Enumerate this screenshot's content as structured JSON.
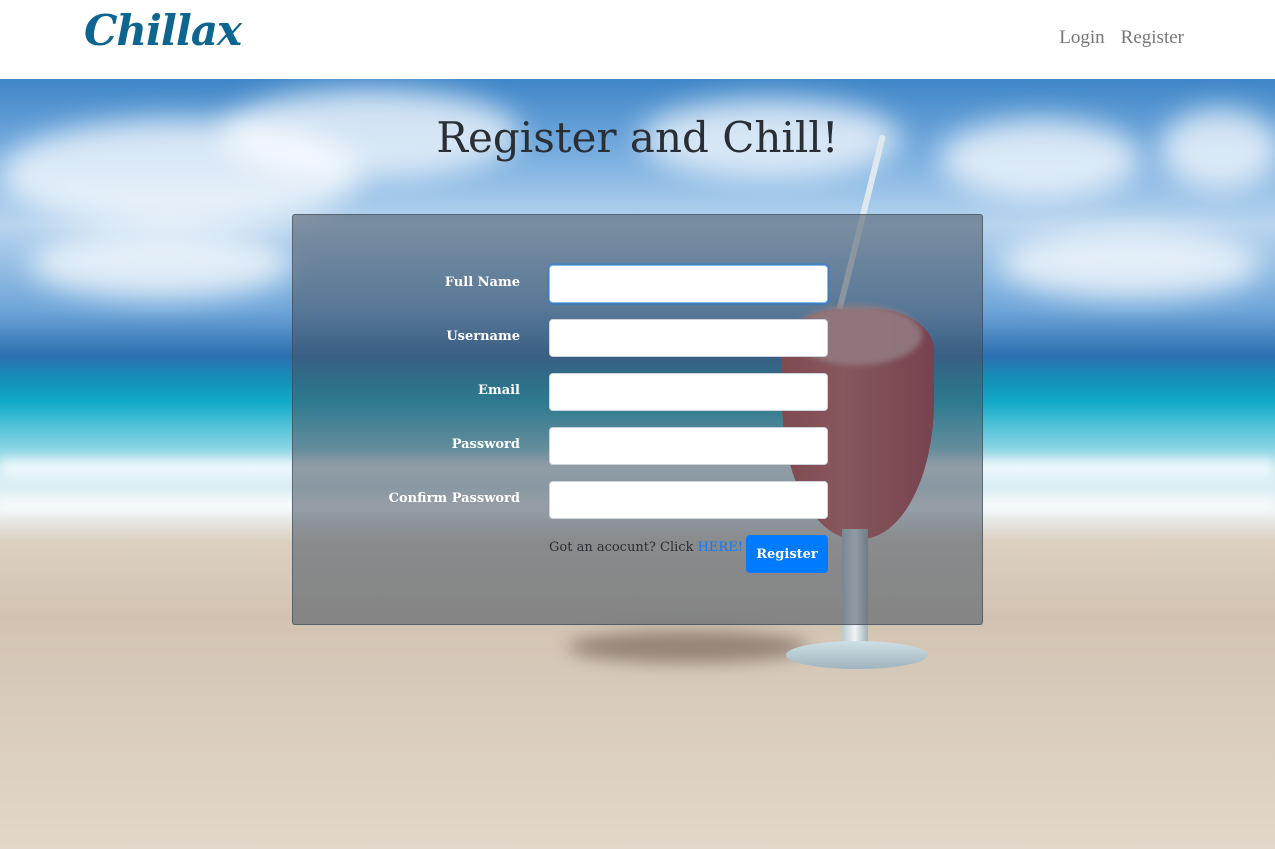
{
  "navbar": {
    "brand": "Chillax",
    "links": [
      "Login",
      "Register"
    ]
  },
  "page": {
    "title": "Register and Chill!"
  },
  "form": {
    "fields": [
      {
        "label": "Full Name",
        "value": ""
      },
      {
        "label": "Username",
        "value": ""
      },
      {
        "label": "Email",
        "value": ""
      },
      {
        "label": "Password",
        "value": ""
      },
      {
        "label": "Confirm Password",
        "value": ""
      }
    ],
    "login_hint_prefix": "Got an acocunt? Click ",
    "login_hint_link": "HERE!",
    "submit_label": "Register"
  },
  "colors": {
    "brand": "#0e6590",
    "accent": "#007bff",
    "link": "#0d7bff"
  }
}
